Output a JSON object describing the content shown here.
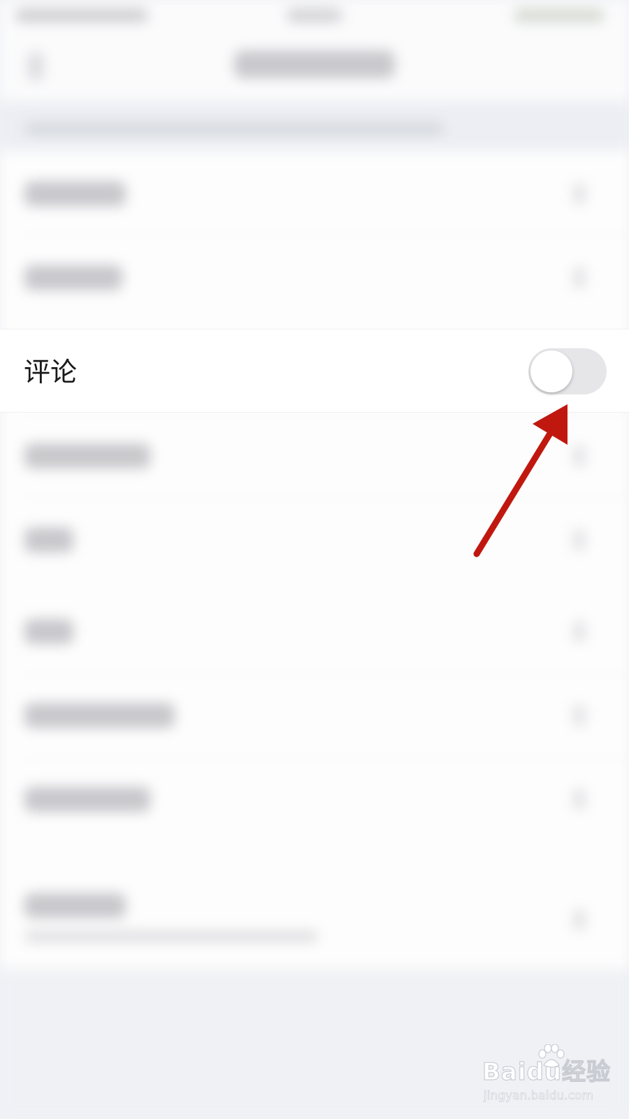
{
  "setting_row": {
    "label": "评论",
    "toggle_state": "off"
  },
  "watermark": {
    "logo_text": "Baidu经验",
    "url_text": "jingyan.baidu.com"
  },
  "colors": {
    "arrow": "#c0180f",
    "toggle_track_off": "#e6e6e9",
    "toggle_knob": "#ffffff",
    "background": "#f0f1f5"
  },
  "icons": {
    "annotation": "red-arrow-icon",
    "watermark": "baidu-paw-icon"
  }
}
